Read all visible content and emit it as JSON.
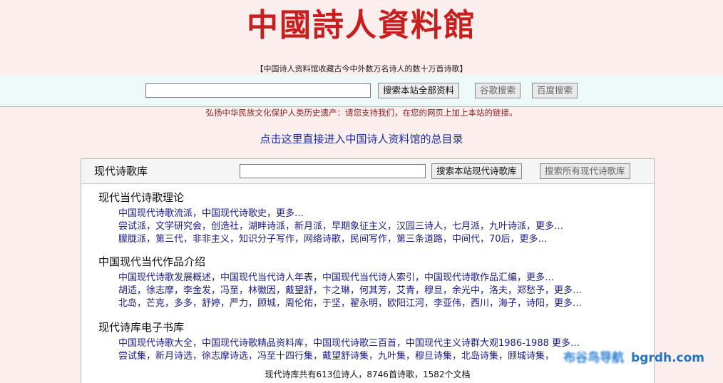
{
  "header": {
    "logo_text": "中國詩人資料館",
    "tagline": "【中国诗人资料馆收藏古今中外数万名诗人的数十万首诗歌】"
  },
  "site_search": {
    "value": "",
    "button_site": "搜索本站全部资料",
    "button_google": "谷歌搜索",
    "button_baidu": "百度搜索"
  },
  "appeal_text": "弘扬中华民族文化保护人类历史遗产：请您支持我们，在您的网页上加上本站的链接。",
  "directory_link": "点击这里直接进入中国诗人资料馆的总目录",
  "panel": {
    "title": "现代诗歌库",
    "search_value": "",
    "button_search_library": "搜索本站现代诗歌库",
    "button_search_all": "搜索所有现代诗歌库",
    "sections": [
      {
        "title": "现代当代诗歌理论",
        "lines": [
          "中国现代诗歌流派，中国现代诗歌史，更多…",
          "尝试派，文学研究会，创造社，湖畔诗派，新月派，早期象征主义，汉园三诗人，七月派，九叶诗派，更多…",
          "朦胧派，第三代，非非主义，知识分子写作，网络诗歌，民间写作，第三条道路，中间代，70后，更多…"
        ]
      },
      {
        "title": "中国现代当代作品介绍",
        "lines": [
          "中国现代诗歌发展概述，中国现代当代诗人年表，中国现代当代诗人索引，中国现代诗歌作品汇编，更多…",
          "胡适，徐志摩，李金发，冯至，林徽因，戴望舒，卞之琳，何其芳，艾青，穆旦，余光中，洛夫，郑愁予，更多…",
          "北岛，芒克，多多，舒婷，严力，顾城，周伦佑，于坚，翟永明，欧阳江河，李亚伟，西川，海子，诗阳，更多…"
        ]
      },
      {
        "title": "现代诗库电子书库",
        "lines": [
          "中国现代诗歌大全，中国现代诗歌精品资料库，中国现代诗歌三百首，中国现代主义诗群大观1986-1988 更多…",
          "尝试集，新月诗选，徐志摩诗选，冯至十四行集，戴望舒诗集，九叶集，穆旦诗集，北岛诗集，顾城诗集，"
        ]
      }
    ],
    "footer_stats": "现代诗库共有613位诗人，8746首诗歌，1582个文档"
  },
  "watermark": {
    "blurred_text": "布谷鸟导航",
    "url_text": "bgrdh.com"
  },
  "colors": {
    "page_bg": "#fdeeee",
    "logo_red": "#c81e1e",
    "search_band_bg": "#eef9f9",
    "link_blue": "#1a2ea8",
    "appeal_red": "#8a1f1f",
    "watermark_blue": "#1f74c6"
  }
}
